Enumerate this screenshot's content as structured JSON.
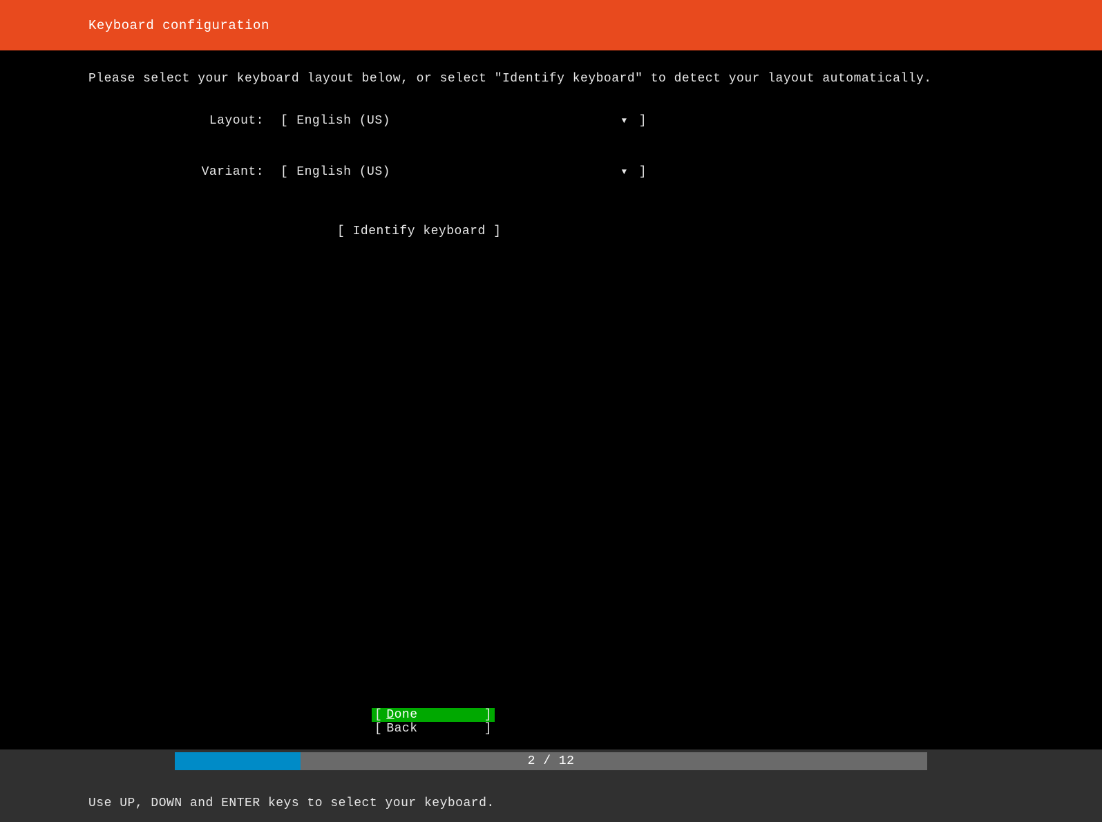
{
  "header": {
    "title": "Keyboard configuration"
  },
  "instruction": "Please select your keyboard layout below, or select \"Identify keyboard\" to detect your layout automatically.",
  "form": {
    "layout": {
      "label": "Layout:",
      "value": "English (US)"
    },
    "variant": {
      "label": "Variant:",
      "value": "English (US)"
    },
    "identify_label": "Identify keyboard"
  },
  "nav": {
    "done": "Done",
    "back": "Back"
  },
  "progress": {
    "current": 2,
    "total": 12,
    "text": "2 / 12"
  },
  "statusbar": {
    "hint": "Use UP, DOWN and ENTER keys to select your keyboard."
  }
}
